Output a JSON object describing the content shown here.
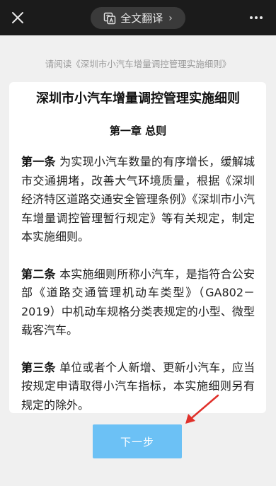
{
  "header": {
    "close_icon": "close-icon",
    "translate_label": "全文翻译",
    "translate_icon": "translate-icon",
    "more_icon": "more-dots-icon"
  },
  "hint": "请阅读《深圳市小汽车增量调控管理实施细则》",
  "document": {
    "title": "深圳市小汽车增量调控管理实施细则",
    "chapter": "第一章 总则",
    "articles": [
      {
        "label": "第一条",
        "text": " 为实现小汽车数量的有序增长，缓解城市交通拥堵，改善大气环境质量，根据《深圳经济特区道路交通安全管理条例》《深圳市小汽车增量调控管理暂行规定》等有关规定，制定本实施细则。"
      },
      {
        "label": "第二条",
        "text": " 本实施细则所称小汽车，是指符合公安部《道路交通管理机动车类型》（GA802－2019）中机动车规格分类表规定的小型、微型载客汽车。"
      },
      {
        "label": "第三条",
        "text": " 单位或者个人新增、更新小汽车，应当按规定申请取得小汽车指标，本实施细则另有规定的除外。"
      }
    ]
  },
  "next_button": "下一步",
  "colors": {
    "topbar": "#1b1b1b",
    "button": "#6cc1f5",
    "annotation_arrow": "#e0302a"
  }
}
